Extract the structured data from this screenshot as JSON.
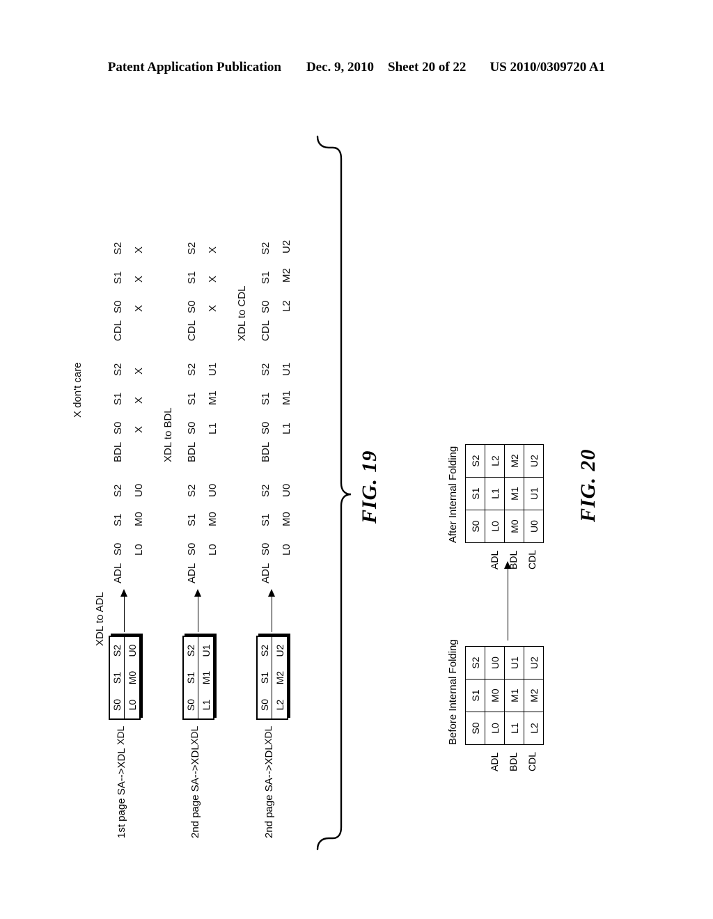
{
  "header": {
    "publication": "Patent Application Publication",
    "date": "Dec. 9, 2010",
    "sheet": "Sheet 20 of 22",
    "patent_number": "US 2010/0309720 A1"
  },
  "fig19": {
    "caption": "FIG. 19",
    "legend": "X don't care",
    "group_headers": {
      "adl": "XDL to ADL",
      "bdl": "XDL to BDL",
      "cdl": "XDL to CDL"
    },
    "latch_labels": {
      "xdl": "XDL",
      "adl": "ADL",
      "bdl": "BDL",
      "cdl": "CDL"
    },
    "state_columns": [
      "S0",
      "S1",
      "S2"
    ],
    "rows": [
      {
        "page_label": "1st page SA-->XDL",
        "xdl": {
          "header": [
            "S0",
            "S1",
            "S2"
          ],
          "values": [
            "L0",
            "M0",
            "U0"
          ]
        },
        "adl": {
          "header": [
            "S0",
            "S1",
            "S2"
          ],
          "values": [
            "L0",
            "M0",
            "U0"
          ]
        },
        "bdl": {
          "header": [
            "S0",
            "S1",
            "S2"
          ],
          "values": [
            "X",
            "X",
            "X"
          ]
        },
        "cdl": {
          "header": [
            "S0",
            "S1",
            "S2"
          ],
          "values": [
            "X",
            "X",
            "X"
          ]
        }
      },
      {
        "page_label": "2nd page SA-->XDL",
        "xdl": {
          "header": [
            "S0",
            "S1",
            "S2"
          ],
          "values": [
            "L1",
            "M1",
            "U1"
          ]
        },
        "adl": {
          "header": [
            "S0",
            "S1",
            "S2"
          ],
          "values": [
            "L0",
            "M0",
            "U0"
          ]
        },
        "bdl": {
          "header": [
            "S0",
            "S1",
            "S2"
          ],
          "values": [
            "L1",
            "M1",
            "U1"
          ]
        },
        "cdl": {
          "header": [
            "S0",
            "S1",
            "S2"
          ],
          "values": [
            "X",
            "X",
            "X"
          ]
        }
      },
      {
        "page_label": "2nd page SA-->XDL",
        "xdl": {
          "header": [
            "S0",
            "S1",
            "S2"
          ],
          "values": [
            "L2",
            "M2",
            "U2"
          ]
        },
        "adl": {
          "header": [
            "S0",
            "S1",
            "S2"
          ],
          "values": [
            "L0",
            "M0",
            "U0"
          ]
        },
        "bdl": {
          "header": [
            "S0",
            "S1",
            "S2"
          ],
          "values": [
            "L1",
            "M1",
            "U1"
          ]
        },
        "cdl": {
          "header": [
            "S0",
            "S1",
            "S2"
          ],
          "values": [
            "L2",
            "M2",
            "U2"
          ]
        }
      }
    ]
  },
  "fig20": {
    "caption": "FIG. 20",
    "before": {
      "title": "Before Internal Folding",
      "columns": [
        "S0",
        "S1",
        "S2"
      ],
      "row_labels": [
        "ADL",
        "BDL",
        "CDL"
      ],
      "cells": [
        [
          "L0",
          "M0",
          "U0"
        ],
        [
          "L1",
          "M1",
          "U1"
        ],
        [
          "L2",
          "M2",
          "U2"
        ]
      ]
    },
    "after": {
      "title": "After Internal Folding",
      "columns": [
        "S0",
        "S1",
        "S2"
      ],
      "row_labels": [
        "ADL",
        "BDL",
        "CDL"
      ],
      "cells": [
        [
          "L0",
          "L1",
          "L2"
        ],
        [
          "M0",
          "M1",
          "M2"
        ],
        [
          "U0",
          "U1",
          "U2"
        ]
      ]
    }
  }
}
